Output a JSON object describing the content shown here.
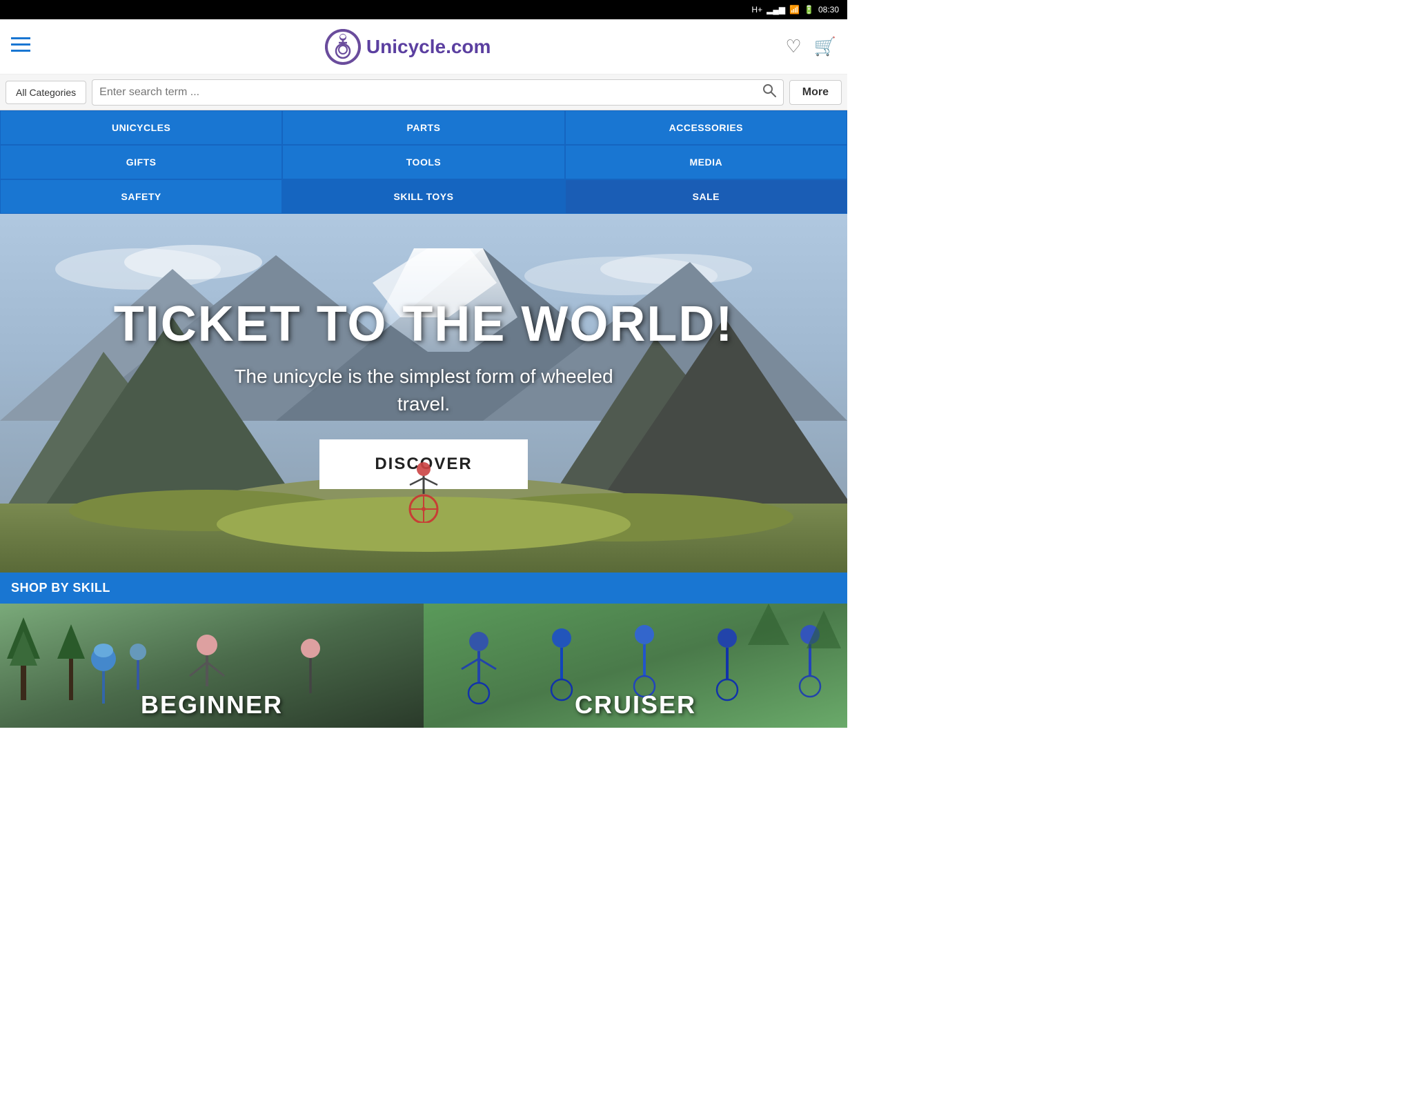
{
  "statusBar": {
    "signal": "H+",
    "bars": "▂▄▆",
    "wifi": "WiFi",
    "battery": "🔋",
    "time": "08:30"
  },
  "header": {
    "logoText": "Unicycle.com",
    "hamburgerIcon": "≡",
    "heartIcon": "♡",
    "cartIcon": "🛒"
  },
  "searchBar": {
    "allCategoriesLabel": "All Categories",
    "searchPlaceholder": "Enter search term ...",
    "moreLabel": "More"
  },
  "navGrid": [
    {
      "id": "unicycles",
      "label": "UNICYCLES"
    },
    {
      "id": "parts",
      "label": "PARTS"
    },
    {
      "id": "accessories",
      "label": "ACCESSORIES"
    },
    {
      "id": "gifts",
      "label": "GIFTS"
    },
    {
      "id": "tools",
      "label": "TOOLS"
    },
    {
      "id": "media",
      "label": "MEDIA"
    },
    {
      "id": "safety",
      "label": "SAFETY"
    },
    {
      "id": "skill-toys",
      "label": "SKILL TOYS"
    },
    {
      "id": "sale",
      "label": "SALE"
    }
  ],
  "hero": {
    "title": "TICKET TO THE WORLD!",
    "subtitle": "The unicycle is the simplest form of wheeled\ntravel.",
    "discoverLabel": "DISCOVER"
  },
  "shopBySkill": {
    "sectionLabel": "SHOP BY SKILL",
    "cards": [
      {
        "id": "beginner",
        "label": "BEGINNER"
      },
      {
        "id": "cruiser",
        "label": "CRUISER"
      }
    ]
  }
}
